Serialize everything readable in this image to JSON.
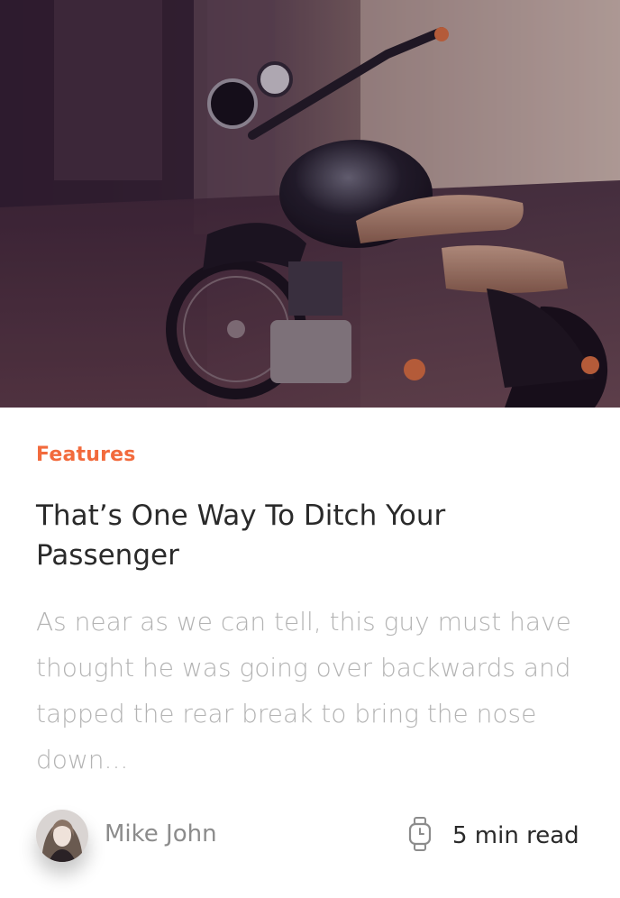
{
  "hero": {
    "image": "motorcycle-photo"
  },
  "article": {
    "category": "Features",
    "title": "That’s One Way To Ditch Your Passenger",
    "excerpt": "As near as we can tell, this guy must have thought he was going over backwards and tapped the rear break to bring the nose down..."
  },
  "meta": {
    "author": "Mike John",
    "read_time": "5 min read",
    "read_time_icon": "watch-icon",
    "avatar_icon": "avatar"
  },
  "colors": {
    "accent": "#f26a3c",
    "title": "#2a2a2a",
    "excerpt": "#b3b3b3",
    "author": "#8c8c8c"
  }
}
